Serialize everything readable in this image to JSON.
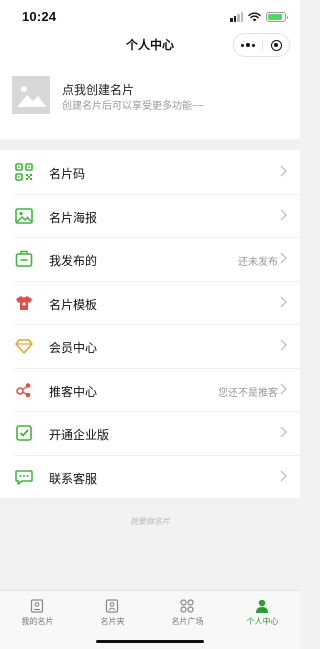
{
  "status_bar": {
    "time": "10:24"
  },
  "nav": {
    "title": "个人中心"
  },
  "profile": {
    "title": "点我创建名片",
    "subtitle": "创建名片后可以享受更多功能~~"
  },
  "menu": [
    {
      "label": "名片码",
      "value": "",
      "icon": "qr-code-icon"
    },
    {
      "label": "名片海报",
      "value": "",
      "icon": "image-icon"
    },
    {
      "label": "我发布的",
      "value": "还未发布",
      "icon": "publish-box-icon"
    },
    {
      "label": "名片模板",
      "value": "",
      "icon": "shirt-icon"
    },
    {
      "label": "会员中心",
      "value": "",
      "icon": "diamond-icon"
    },
    {
      "label": "推客中心",
      "value": "您还不是推客",
      "icon": "share-nodes-icon"
    },
    {
      "label": "开通企业版",
      "value": "",
      "icon": "check-doc-icon"
    },
    {
      "label": "联系客服",
      "value": "",
      "icon": "chat-bubble-icon"
    }
  ],
  "footer": {
    "text": "我要做名片"
  },
  "tabs": [
    {
      "label": "我的名片",
      "icon": "card-icon",
      "active": false
    },
    {
      "label": "名片夹",
      "icon": "card-holder-icon",
      "active": false
    },
    {
      "label": "名片广场",
      "icon": "grid-icon",
      "active": false
    },
    {
      "label": "个人中心",
      "icon": "person-icon",
      "active": true
    }
  ],
  "colors": {
    "accent": "#2c9a2c",
    "menu_icon_green": "#3db53d",
    "menu_icon_red": "#e0504a",
    "menu_icon_gold": "#e0a532"
  }
}
